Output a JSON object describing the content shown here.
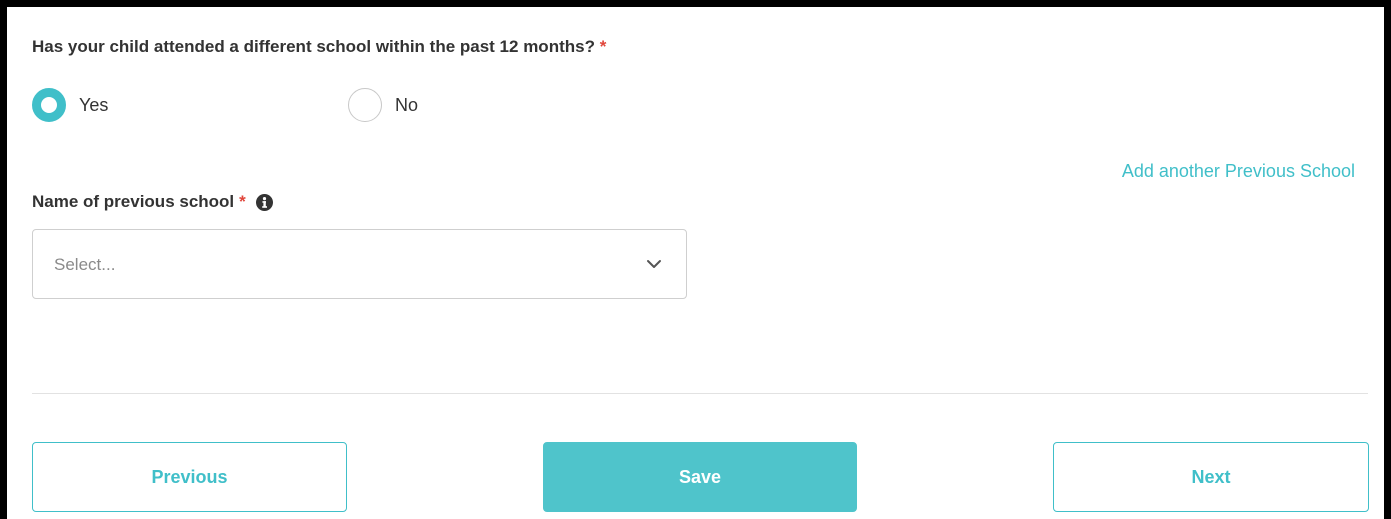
{
  "question": {
    "text": "Has your child attended a different school within the past 12 months?",
    "required_marker": "*"
  },
  "radio_options": [
    {
      "label": "Yes",
      "selected": true
    },
    {
      "label": "No",
      "selected": false
    }
  ],
  "add_link": "Add another Previous School",
  "field": {
    "label": "Name of previous school",
    "required_marker": "*",
    "info_icon": "info-circle-icon"
  },
  "select": {
    "placeholder": "Select...",
    "icon": "chevron-down-icon"
  },
  "buttons": {
    "previous": "Previous",
    "save": "Save",
    "next": "Next"
  },
  "colors": {
    "accent": "#40bfc9",
    "save_button": "#4fc4cb",
    "required": "#e0453a",
    "text": "#333333",
    "placeholder": "#8a8a8a"
  }
}
